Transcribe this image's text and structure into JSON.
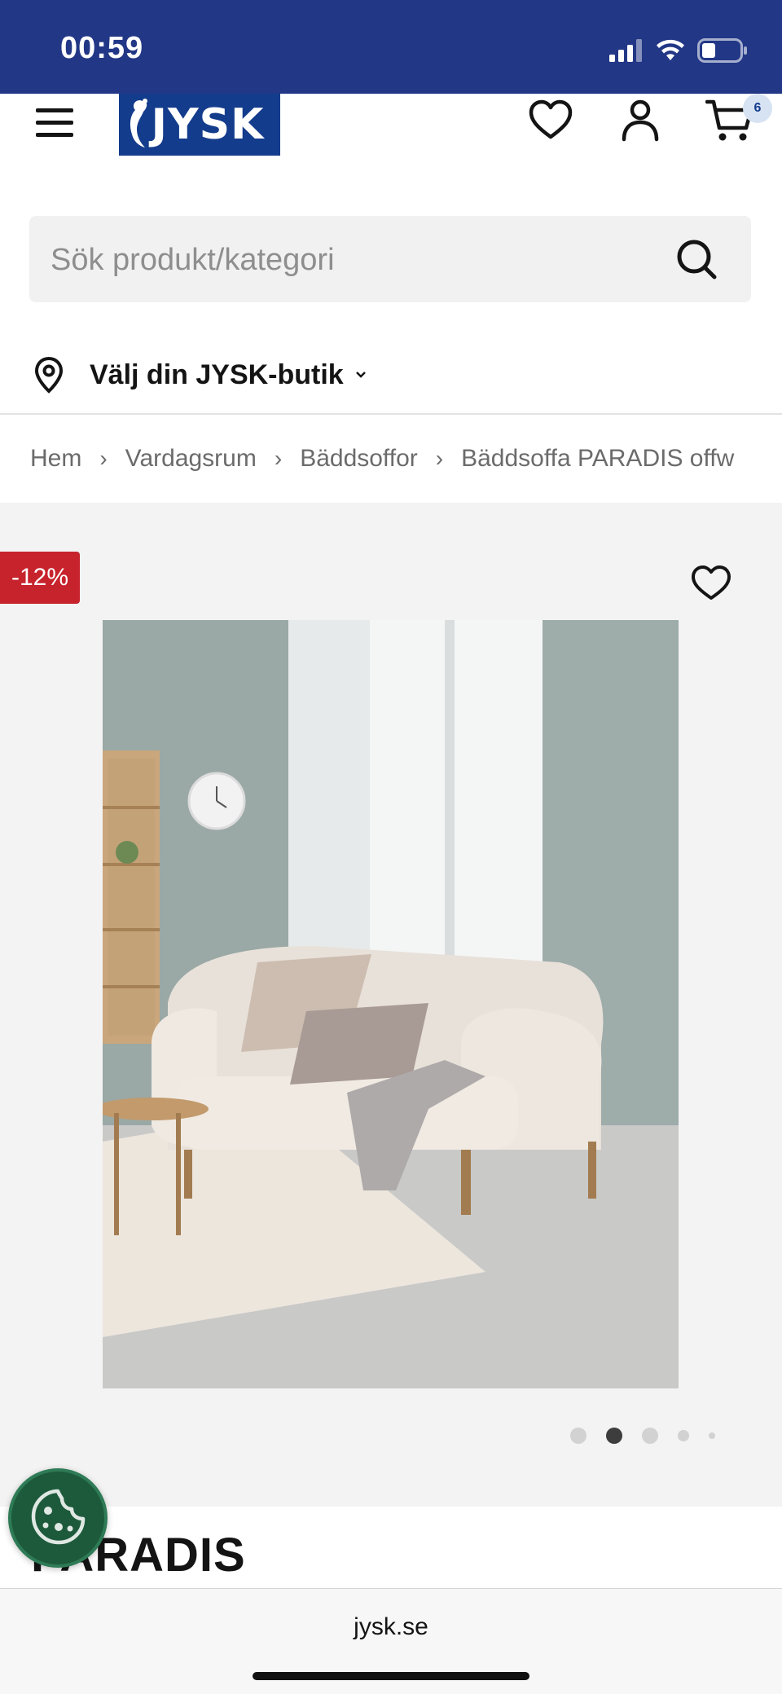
{
  "status_bar": {
    "time": "00:59",
    "icons": [
      "signal-icon",
      "wifi-icon",
      "battery-icon"
    ]
  },
  "header": {
    "logo_text": "JYSK",
    "icons": [
      "menu-icon",
      "heart-icon",
      "user-icon",
      "cart-icon"
    ],
    "cart_count": "6"
  },
  "search": {
    "placeholder": "Sök produkt/kategori"
  },
  "store_picker": {
    "label": "Välj din JYSK-butik"
  },
  "breadcrumb": {
    "items": [
      "Hem",
      "Vardagsrum",
      "Bäddsoffor",
      "Bäddsoffa PARADIS offw"
    ],
    "separator": "›"
  },
  "product": {
    "discount_badge": "-12%",
    "title": "PARADIS",
    "gallery": {
      "image_count": 5,
      "active_index": 1
    }
  },
  "browser": {
    "url": "jysk.se"
  },
  "colors": {
    "status_bar": "#223786",
    "brand_blue": "#143c8c",
    "discount_red": "#c7232d",
    "cookie_green": "#1d5a3c"
  }
}
